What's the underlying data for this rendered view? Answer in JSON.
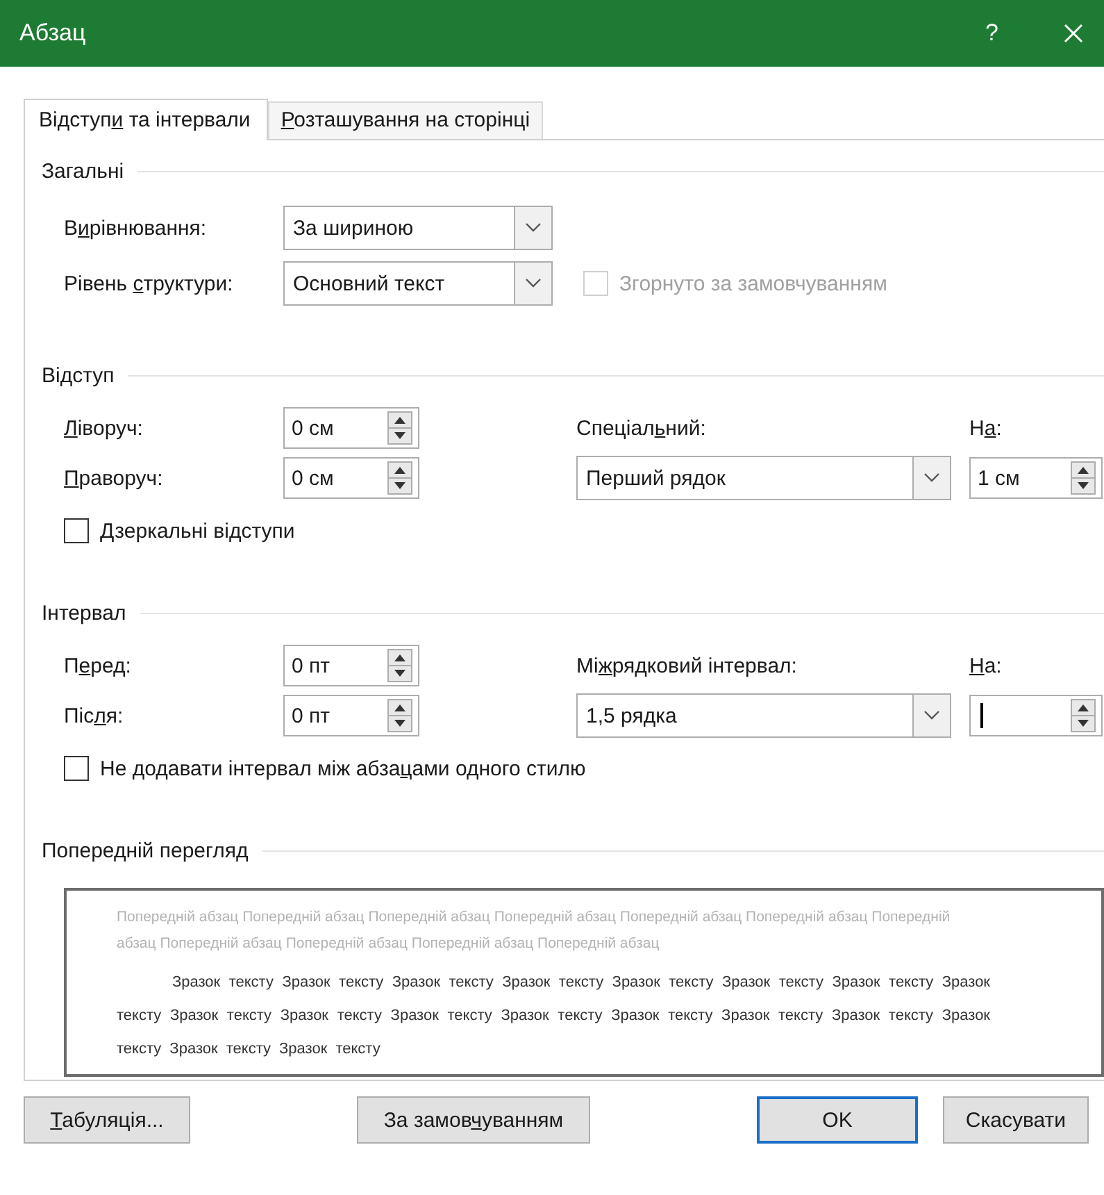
{
  "window": {
    "title": "Абзац",
    "help": "?"
  },
  "tabs": [
    {
      "label_before": "Відступ",
      "access_key": "и",
      "label_after": " та інтервали",
      "selected": true
    },
    {
      "access_key": "Р",
      "label_after": "озташування на сторінці",
      "selected": false
    }
  ],
  "general": {
    "heading": "Загальні",
    "alignment": {
      "label_before": "В",
      "access_key": "и",
      "label_after": "рівнювання:",
      "value": "За шириною"
    },
    "outline_level": {
      "label_before": "Рівень ",
      "access_key": "с",
      "label_after": "труктури:",
      "value": "Основний текст"
    },
    "collapsed": {
      "label": "Згорнуто за замовчуванням",
      "checked": false,
      "disabled": true
    }
  },
  "indent": {
    "heading": "Відступ",
    "left": {
      "access_key": "Л",
      "label_after": "іворуч:",
      "value": "0 см"
    },
    "right": {
      "access_key": "П",
      "label_after": "раворуч:",
      "value": "0 см"
    },
    "special": {
      "label_before": "Спеціал",
      "access_key": "ь",
      "label_after": "ний:",
      "value": "Перший рядок"
    },
    "by": {
      "label_before": "Н",
      "access_key": "а",
      "label_after": ":",
      "value": "1 см"
    },
    "mirror": {
      "access_key": "Д",
      "label_after": "зеркальні відступи",
      "checked": false
    }
  },
  "spacing": {
    "heading": "Інтервал",
    "before": {
      "label_before": "П",
      "access_key": "е",
      "label_after": "ред:",
      "value": "0 пт"
    },
    "after": {
      "label_before": "Піс",
      "access_key": "л",
      "label_after": "я:",
      "value": "0 пт"
    },
    "line_spacing": {
      "label_before": "Мі",
      "access_key": "ж",
      "label_after": "рядковий інтервал:",
      "value": "1,5 рядка"
    },
    "at": {
      "access_key": "Н",
      "label_after": "а:",
      "focused": true
    },
    "dont_add": {
      "label_before": "Не додавати інтервал між абза",
      "access_key": "ц",
      "label_after": "ами одного стилю",
      "checked": false
    }
  },
  "preview": {
    "heading": "Попередній перегляд",
    "previous_text": "Попередній абзац Попередній абзац Попередній абзац Попередній абзац Попередній абзац Попередній абзац Попередній абзац Попередній абзац Попередній абзац Попередній абзац Попередній абзац",
    "sample_text": "Зразок тексту Зразок тексту Зразок тексту Зразок тексту Зразок тексту Зразок тексту Зразок тексту Зразок тексту Зразок тексту Зразок тексту Зразок тексту Зразок тексту Зразок тексту Зразок тексту Зразок тексту Зразок тексту Зразок тексту Зразок тексту"
  },
  "buttons": [
    {
      "access_key": "Т",
      "label_after": "абуляція...",
      "default": false
    },
    {
      "label_before": "За замов",
      "access_key": "ч",
      "label_after": "уванням",
      "default": false
    },
    {
      "label": "OK",
      "default": true
    },
    {
      "label": "Скасувати",
      "default": false
    }
  ]
}
